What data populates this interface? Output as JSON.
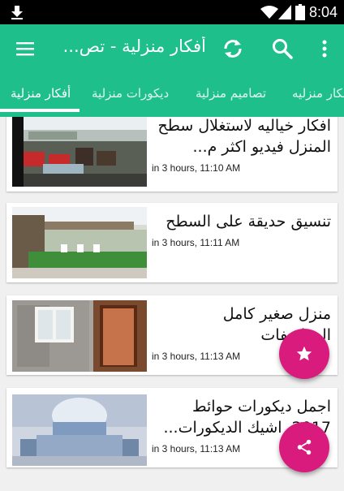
{
  "status_bar": {
    "time": "8:04"
  },
  "app_bar": {
    "title": "أفكار منزلية - تص..."
  },
  "tabs": [
    {
      "label": "أفكار منزلية"
    },
    {
      "label": "ديكورات منزلية"
    },
    {
      "label": "تصاميم منزلية"
    },
    {
      "label": "أفكار منزليه"
    }
  ],
  "articles": [
    {
      "title": "افكار خياليه لاستغلال سطح المنزل فيديو اكثر م...",
      "time": "in 3 hours, 11:10 AM"
    },
    {
      "title": "تنسيق حديقة على السطح",
      "time": "in 3 hours, 11:11 AM"
    },
    {
      "title": "منزل صغير كامل المواصفات",
      "time": "in 3 hours, 11:13 AM"
    },
    {
      "title": "اجمل ديكورات حوائط 2017, اشيك الديكورات...",
      "time": "in 3 hours, 11:13 AM"
    }
  ],
  "colors": {
    "primary": "#1ebf8a",
    "accent": "#d81b7d"
  },
  "icons": {
    "status": [
      "download-icon",
      "wifi-icon",
      "signal-icon",
      "battery-icon"
    ],
    "app_bar": [
      "menu-icon",
      "refresh-icon",
      "search-icon",
      "more-vert-icon"
    ],
    "fabs": [
      "star-icon",
      "share-icon"
    ]
  }
}
